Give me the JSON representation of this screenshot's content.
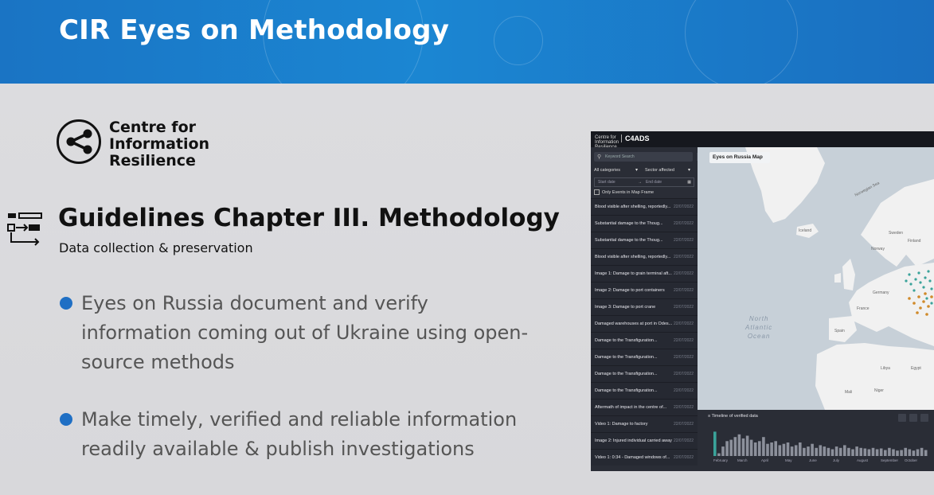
{
  "slide": {
    "title": "CIR Eyes on Methodology",
    "logo_text": "Centre for\nInformation\nResilience",
    "heading": "Guidelines Chapter III. Methodology",
    "subheading": "Data collection & preservation",
    "bullets": [
      "Eyes on Russia document and verify information coming out of Ukraine using open-source methods",
      "Make timely, verified and reliable information readily available & publish investigations"
    ],
    "colors": {
      "banner": "#1b7fcf",
      "bullet": "#1f6fc4",
      "text": "#555555",
      "heading": "#111111"
    }
  },
  "app": {
    "brand_small": "Centre for Information Resilience",
    "brand_large": "C4ADS",
    "search_placeholder": "Keyword Search",
    "filter_category": "All categories",
    "filter_sector": "Sector affected",
    "date_start": "Start date",
    "date_end": "End date",
    "checkbox_label": "Only Events in Map Frame",
    "map_title": "Eyes on Russia Map",
    "map_labels": {
      "norwegian_sea": "Norwegian Sea",
      "iceland": "Iceland",
      "sweden": "Sweden",
      "finland": "Finland",
      "norway": "Norway",
      "ocean": "North\nAtlantic\nOcean",
      "germany": "Germany",
      "france": "France",
      "spain": "Spain",
      "egypt": "Egypt",
      "libya": "Libya",
      "niger": "Niger",
      "mali": "Mali"
    },
    "events": [
      {
        "title": "Blood visible after shelling, reportedly...",
        "date": "22/07/2022"
      },
      {
        "title": "Substantial damage to the Thoug...",
        "date": "22/07/2022"
      },
      {
        "title": "Substantial damage to the Thoug...",
        "date": "22/07/2022"
      },
      {
        "title": "Blood visible after shelling, reportedly...",
        "date": "22/07/2022"
      },
      {
        "title": "Image 1: Damage to grain terminal aft...",
        "date": "22/07/2022"
      },
      {
        "title": "Image 2: Damage to port containers",
        "date": "22/07/2022"
      },
      {
        "title": "Image 3: Damage to port crane",
        "date": "22/07/2022"
      },
      {
        "title": "Damaged warehouses at port in Odes...",
        "date": "22/07/2022"
      },
      {
        "title": "Damage to the Transfiguration...",
        "date": "22/07/2022"
      },
      {
        "title": "Damage to the Transfiguration...",
        "date": "22/07/2022"
      },
      {
        "title": "Damage to the Transfiguration...",
        "date": "22/07/2022"
      },
      {
        "title": "Damage to the Transfiguration...",
        "date": "22/07/2022"
      },
      {
        "title": "Aftermath of impact in the centre of...",
        "date": "22/07/2022"
      },
      {
        "title": "Video 1: Damage to factory",
        "date": "22/07/2022"
      },
      {
        "title": "Image 2: Injured individual carried away",
        "date": "22/07/2022"
      },
      {
        "title": "Video 1: 0:34 - Damaged windows of...",
        "date": "22/07/2022"
      }
    ],
    "timeline": {
      "title": "Timeline of verified data",
      "months": [
        "February",
        "March",
        "April",
        "May",
        "June",
        "July",
        "August",
        "September",
        "October"
      ],
      "bars": [
        0.9,
        0.1,
        0.35,
        0.55,
        0.6,
        0.7,
        0.8,
        0.65,
        0.75,
        0.6,
        0.5,
        0.55,
        0.7,
        0.45,
        0.5,
        0.55,
        0.4,
        0.45,
        0.5,
        0.35,
        0.4,
        0.5,
        0.3,
        0.35,
        0.45,
        0.3,
        0.4,
        0.35,
        0.3,
        0.25,
        0.35,
        0.3,
        0.4,
        0.3,
        0.25,
        0.35,
        0.3,
        0.28,
        0.25,
        0.3,
        0.25,
        0.28,
        0.22,
        0.3,
        0.25,
        0.2,
        0.22,
        0.3,
        0.25,
        0.2,
        0.25,
        0.3,
        0.22
      ]
    }
  }
}
